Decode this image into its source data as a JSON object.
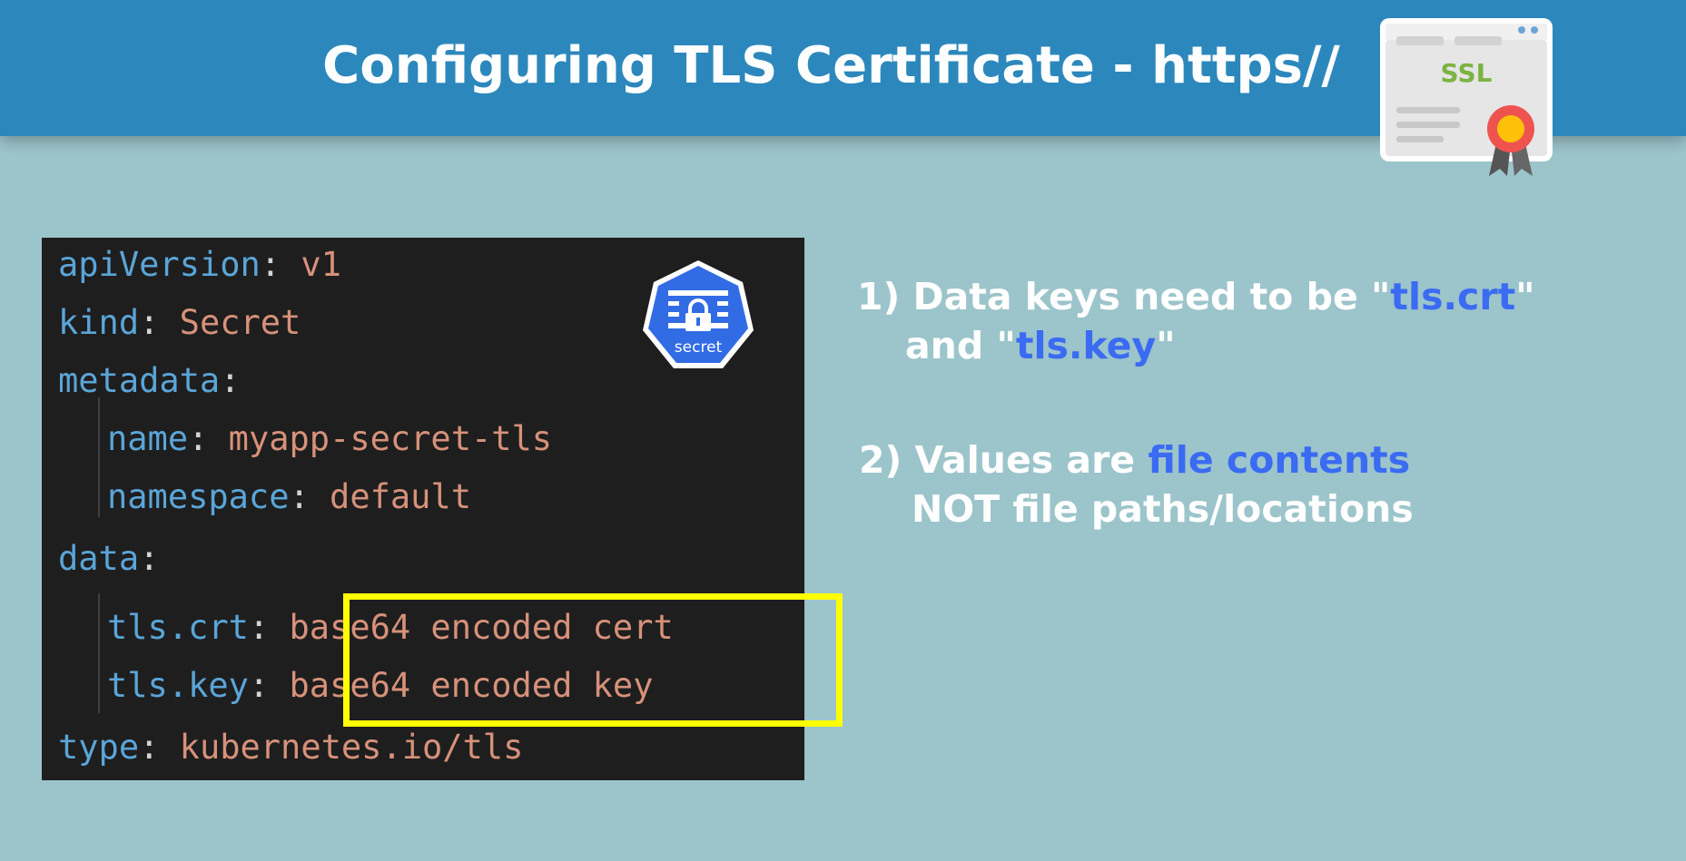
{
  "header": {
    "title": "Configuring TLS Certificate - https//",
    "ssl_badge": "SSL",
    "icon": "ssl-certificate-icon"
  },
  "code": {
    "lines": [
      {
        "key": "apiVersion",
        "value": "v1",
        "indent": 0
      },
      {
        "key": "kind",
        "value": "Secret",
        "indent": 0
      },
      {
        "key": "metadata",
        "value": "",
        "indent": 0
      },
      {
        "key": "name",
        "value": "myapp-secret-tls",
        "indent": 1
      },
      {
        "key": "namespace",
        "value": "default",
        "indent": 1
      },
      {
        "key": "data",
        "value": "",
        "indent": 0
      },
      {
        "key": "tls.crt",
        "value": "base64 encoded cert",
        "indent": 1
      },
      {
        "key": "tls.key",
        "value": "base64 encoded key",
        "indent": 1
      },
      {
        "key": "type",
        "value": "kubernetes.io/tls",
        "indent": 0
      }
    ],
    "secret_icon_label": "secret",
    "secret_icon": "kubernetes-secret-icon"
  },
  "points": {
    "p1": {
      "line1_prefix": "1) Data keys need to be \"",
      "line1_hl": "tls.crt",
      "line1_suffix": "\"",
      "line2_prefix": "and \"",
      "line2_hl": "tls.key",
      "line2_suffix": "\""
    },
    "p2": {
      "line1_prefix": "2) Values are ",
      "line1_hl": "file contents",
      "line2": "NOT file paths/locations"
    }
  },
  "colors": {
    "header_bg": "#2c88bc",
    "page_bg": "#9cc4cb",
    "highlight_text": "#3a6bf2",
    "highlight_box": "#ffff00",
    "code_key": "#5aa5d8",
    "code_value": "#d7917a"
  }
}
